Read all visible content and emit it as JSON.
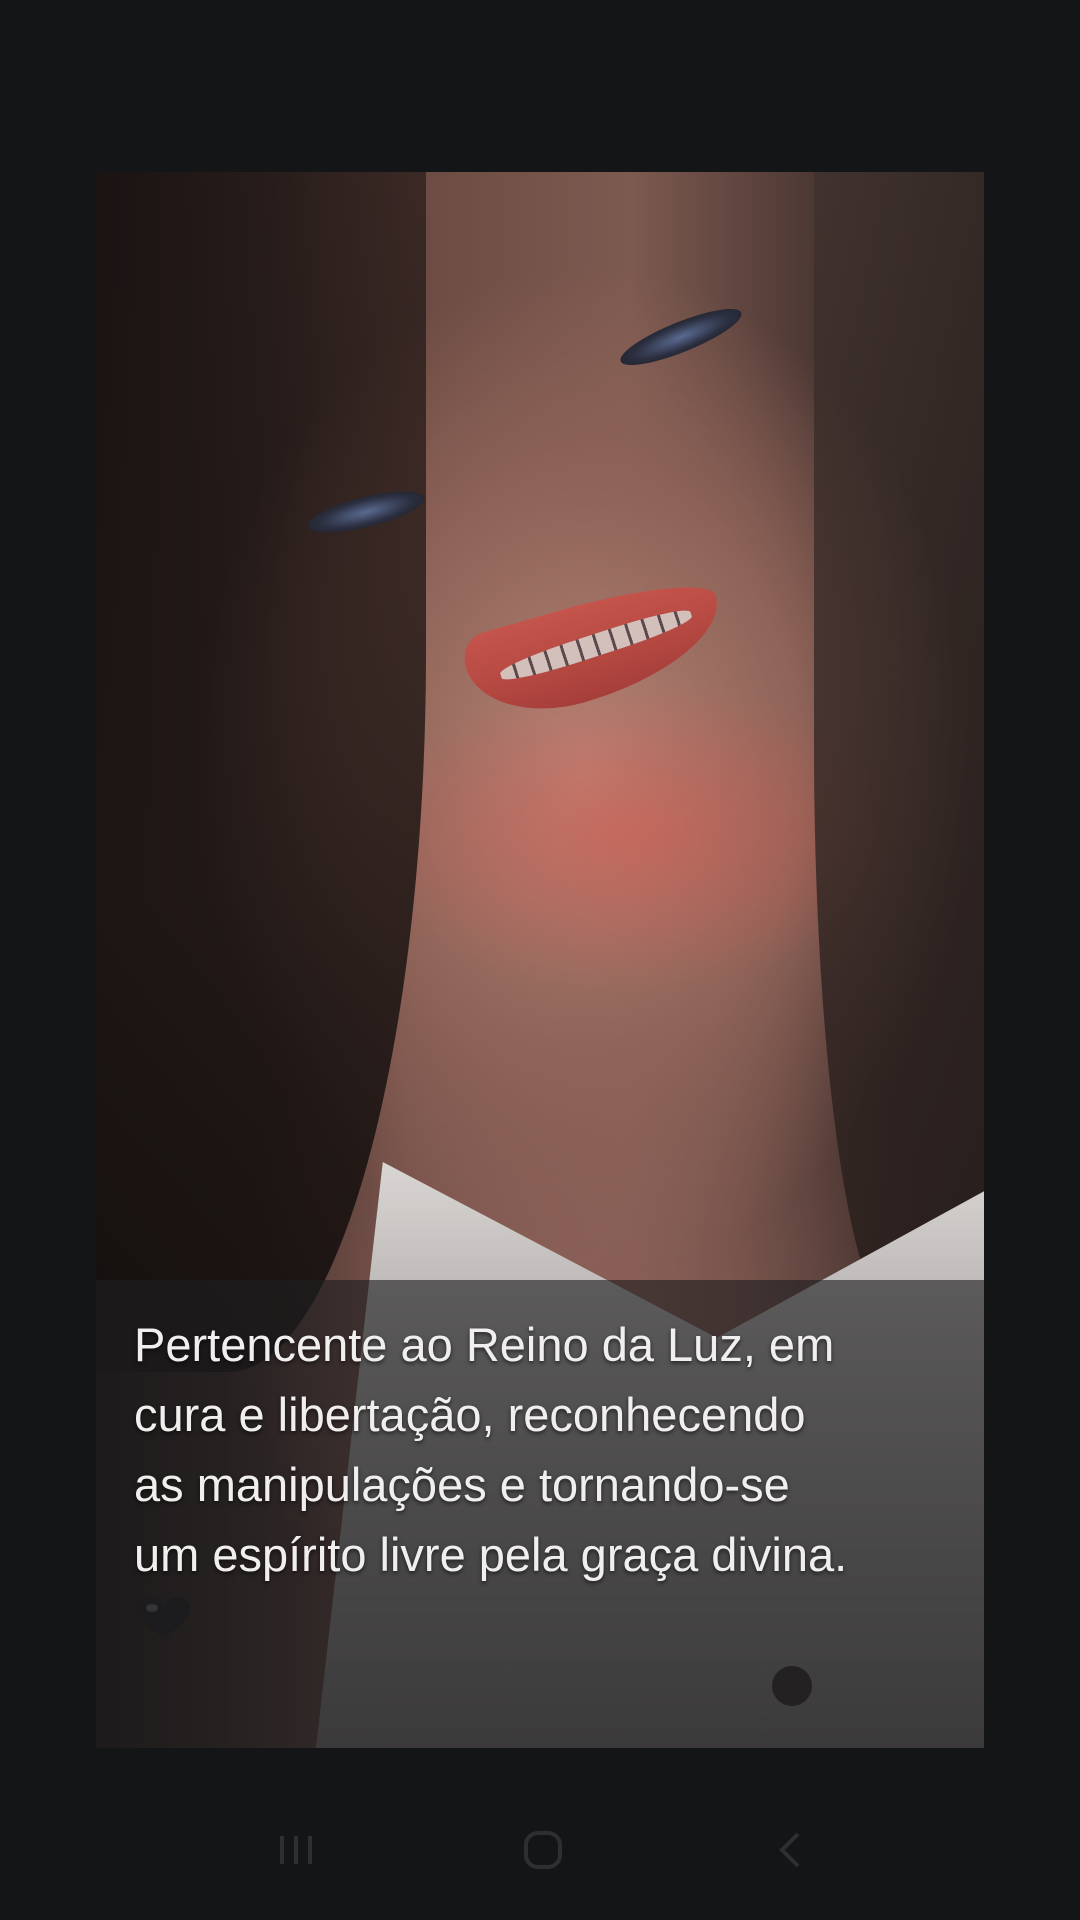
{
  "story": {
    "caption_lines": [
      "Pertencente ao Reino da Luz, em",
      "cura e libertação, reconhecendo",
      "as manipulações e tornando-se",
      "um espírito livre pela graça divina."
    ],
    "caption_emoji_icon": "black-heart-icon",
    "photo_subject": "smiling-woman-portrait"
  },
  "nav_bar": {
    "buttons": [
      {
        "name": "recents",
        "icon": "recents-icon"
      },
      {
        "name": "home",
        "icon": "home-icon"
      },
      {
        "name": "back",
        "icon": "back-icon"
      }
    ]
  },
  "colors": {
    "background": "#141516",
    "caption_text": "#f0efee",
    "caption_panel": "rgba(30,30,32,0.62)",
    "nav_icon": "#2e2f31"
  }
}
